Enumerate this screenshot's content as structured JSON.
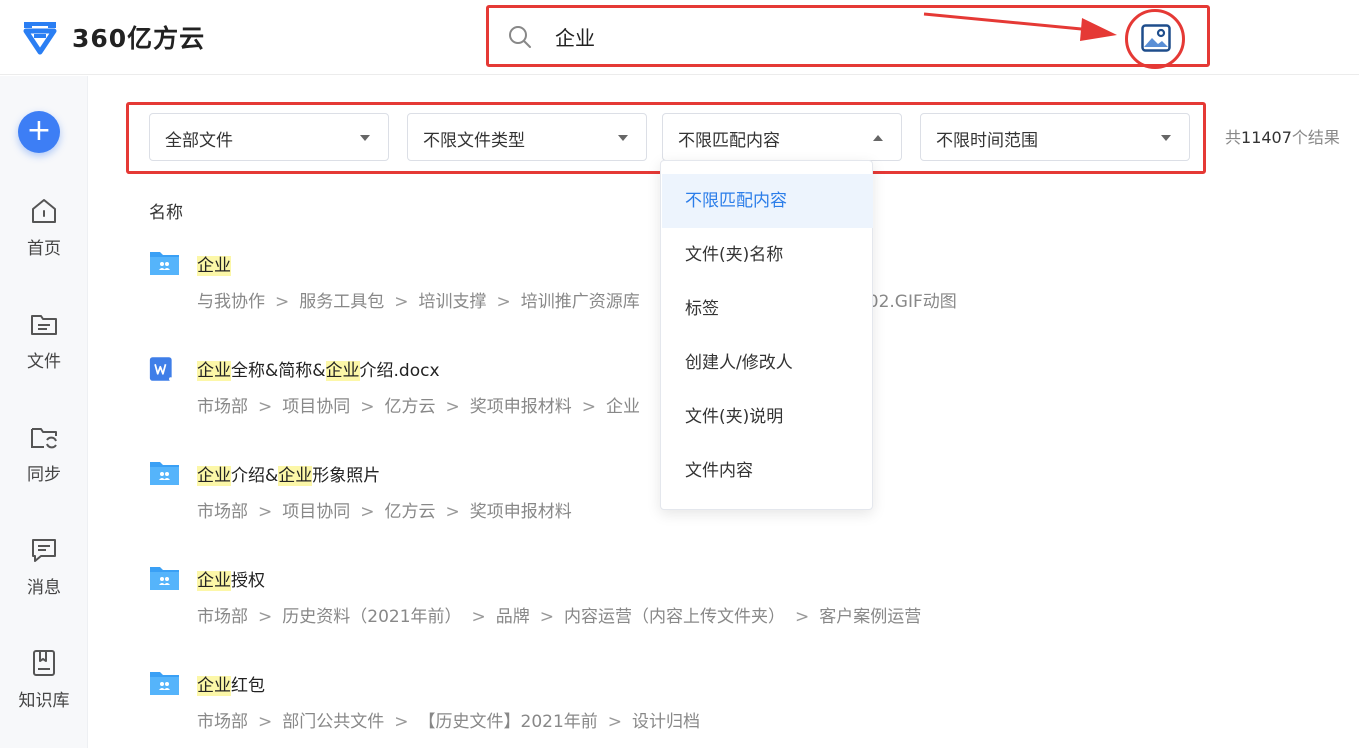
{
  "app": {
    "logo_text": "360亿方云"
  },
  "search": {
    "value": "企业"
  },
  "sidebar": {
    "add_label": "+",
    "items": [
      {
        "label": "首页",
        "icon": "home-icon"
      },
      {
        "label": "文件",
        "icon": "folder-icon"
      },
      {
        "label": "同步",
        "icon": "sync-folder-icon"
      },
      {
        "label": "消息",
        "icon": "message-icon"
      },
      {
        "label": "知识库",
        "icon": "knowledge-base-icon"
      }
    ]
  },
  "filters": {
    "scope": "全部文件",
    "type": "不限文件类型",
    "match": "不限匹配内容",
    "time": "不限时间范围",
    "result_count_prefix": "共",
    "result_count": "11407",
    "result_count_suffix": "个结果"
  },
  "list": {
    "column_header": "名称",
    "rows": [
      {
        "name_parts": [
          "企业",
          ""
        ],
        "path": [
          "与我协作",
          "服务工具包",
          "培训支撑",
          "培训推广资源库",
          "02.GIF动图"
        ],
        "icon": "shared-folder-icon"
      },
      {
        "name_parts": [
          "企业",
          "全称&简称&",
          "企业",
          "介绍.docx"
        ],
        "path": [
          "市场部",
          "项目协同",
          "亿方云",
          "奖项申报材料",
          "企业"
        ],
        "icon": "word-doc-icon"
      },
      {
        "name_parts": [
          "企业",
          "介绍&",
          "企业",
          "形象照片"
        ],
        "path": [
          "市场部",
          "项目协同",
          "亿方云",
          "奖项申报材料"
        ],
        "icon": "shared-folder-icon"
      },
      {
        "name_parts": [
          "企业",
          "授权"
        ],
        "path": [
          "市场部",
          "历史资料（2021年前）",
          "品牌",
          "内容运营（内容上传文件夹）",
          "客户案例运营"
        ],
        "icon": "shared-folder-icon"
      },
      {
        "name_parts": [
          "企业",
          "红包"
        ],
        "path": [
          "市场部",
          "部门公共文件",
          "【历史文件】2021年前",
          "设计归档"
        ],
        "icon": "shared-folder-icon"
      }
    ]
  },
  "dropdown": {
    "options": [
      "不限匹配内容",
      "文件(夹)名称",
      "标签",
      "创建人/修改人",
      "文件(夹)说明",
      "文件内容"
    ],
    "selected_index": 0
  },
  "colors": {
    "accent": "#3d7ef5",
    "highlight": "#fcf7a8",
    "annotation": "#e53935"
  }
}
